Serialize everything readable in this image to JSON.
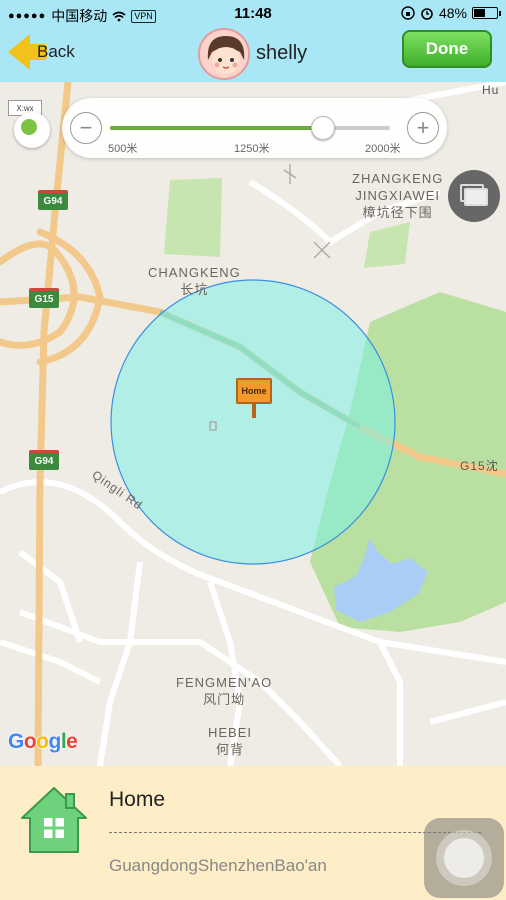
{
  "status_bar": {
    "carrier": "中国移动",
    "signal_dots": "●●●●●",
    "wifi_icon": "wifi-icon",
    "vpn": "VPN",
    "time": "11:48",
    "battery": "48%",
    "battery_level": 0.48
  },
  "nav": {
    "back_label": "Back",
    "user_name": "shelly",
    "done_label": "Done"
  },
  "map": {
    "compass_tag": "X:wx",
    "radius_slider": {
      "min_symbol": "−",
      "max_symbol": "+",
      "ticks": [
        "500米",
        "1250米",
        "2000米"
      ],
      "value_fraction": 0.76
    },
    "labels": {
      "changkeng": "CHANGKENG",
      "changkeng_cn": "长坑",
      "zhangkeng": "ZHANGKENG",
      "jingxiawei": "JINGXIAWEI",
      "zhangkeng_cn": "樟坑径下围",
      "fengmenao": "FENGMEN'AO",
      "fengmenao_cn": "风门坳",
      "hebei": "HEBEI",
      "hebei_cn": "何背",
      "qingli_rd": "Qingli Rd",
      "g15_road": "G15沈",
      "hu_road": "Hu"
    },
    "road_badges": [
      "G94",
      "G15",
      "G94"
    ],
    "marker_label": "Home",
    "google_logo": "Google",
    "colors": {
      "circle_fill": "#7ef2e6",
      "circle_stroke": "#3b8fe0",
      "park_green": "#bfe3a4",
      "water": "#a9cdf5",
      "highway": "#f2c98b"
    }
  },
  "bottom": {
    "title": "Home",
    "address": "GuangdongShenzhenBao'an"
  }
}
